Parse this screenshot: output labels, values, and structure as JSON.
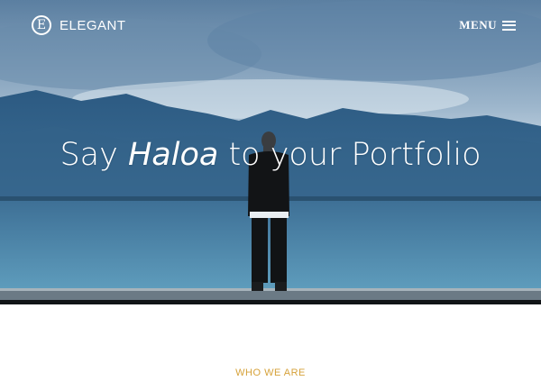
{
  "brand": {
    "logo_letter": "E",
    "name": "ELEGANT",
    "logo_icon": "circle-e-logo"
  },
  "nav": {
    "menu_label": "MENU",
    "menu_icon": "hamburger-icon"
  },
  "hero": {
    "headline_prefix": "Say ",
    "headline_emphasis": "Haloa",
    "headline_suffix": " to your Portfolio"
  },
  "section": {
    "label": "WHO WE ARE"
  },
  "colors": {
    "accent": "#d6a23a",
    "hero_overlay": "#5f82a3",
    "text_light": "#ffffff"
  }
}
